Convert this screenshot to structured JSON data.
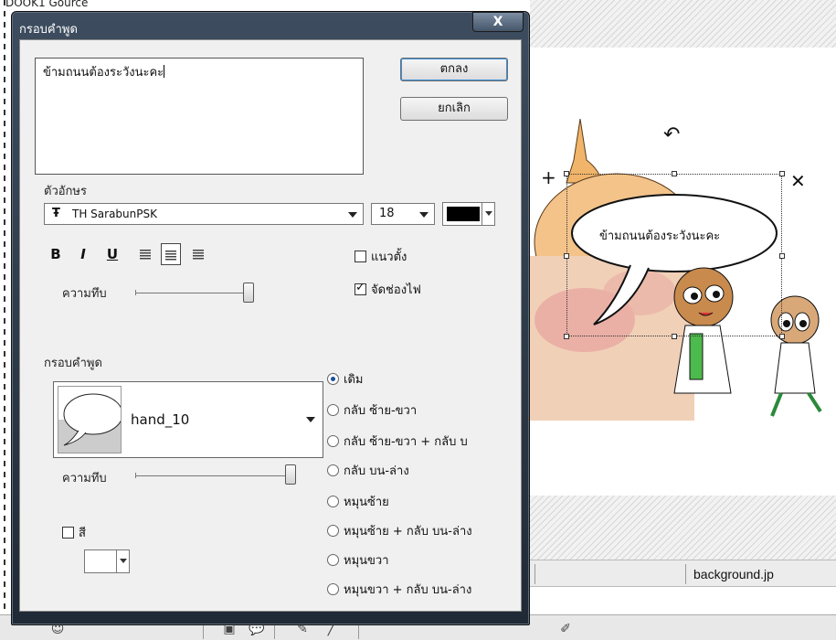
{
  "background": {
    "top_clipped_text": "DOOK1 Gource",
    "file_bar": {
      "filename": "background.jp"
    },
    "speech_bubble_text": "ข้ามถนนต้องระวังนะคะ",
    "toolbar_items": [
      "",
      "",
      "",
      "",
      "",
      ""
    ],
    "colors": {
      "canvas_bg": "#ffffff",
      "hatch": "#d6d6d6"
    }
  },
  "dialog": {
    "title": "กรอบคำพูด",
    "close_label": "X",
    "text_value": "ข้ามถนนต้องระวังนะคะ",
    "ok_label": "ตกลง",
    "cancel_label": "ยกเลิก",
    "font_section_label": "ตัวอักษร",
    "font_name": "TH SarabunPSK",
    "font_size": "18",
    "font_color": "#000000",
    "format_buttons": [
      {
        "name": "bold-button",
        "glyph": "B"
      },
      {
        "name": "italic-button",
        "glyph": "I"
      },
      {
        "name": "underline-button",
        "glyph": "U"
      }
    ],
    "align_buttons": [
      "align-left",
      "align-center",
      "align-right"
    ],
    "vertical_label": "แนวตั้ง",
    "vertical_checked": false,
    "fit_label": "จัดช่องไฟ",
    "fit_checked": true,
    "text_opacity_label": "ความทึบ",
    "text_opacity": 1.0,
    "bubble_section_label": "กรอบคำพูด",
    "bubble_style_name": "hand_10",
    "bubble_opacity_label": "ความทึบ",
    "bubble_opacity": 1.0,
    "color_label": "สี",
    "color_checked": false,
    "transform_options": [
      {
        "label": "เดิม",
        "selected": true
      },
      {
        "label": "กลับ ซ้าย-ขวา",
        "selected": false
      },
      {
        "label": "กลับ ซ้าย-ขวา + กลับ บ",
        "selected": false
      },
      {
        "label": "กลับ บน-ล่าง",
        "selected": false
      },
      {
        "label": "หมุนซ้าย",
        "selected": false
      },
      {
        "label": "หมุนซ้าย + กลับ บน-ล่าง",
        "selected": false
      },
      {
        "label": "หมุนขวา",
        "selected": false
      },
      {
        "label": "หมุนขวา + กลับ บน-ล่าง",
        "selected": false
      }
    ]
  }
}
